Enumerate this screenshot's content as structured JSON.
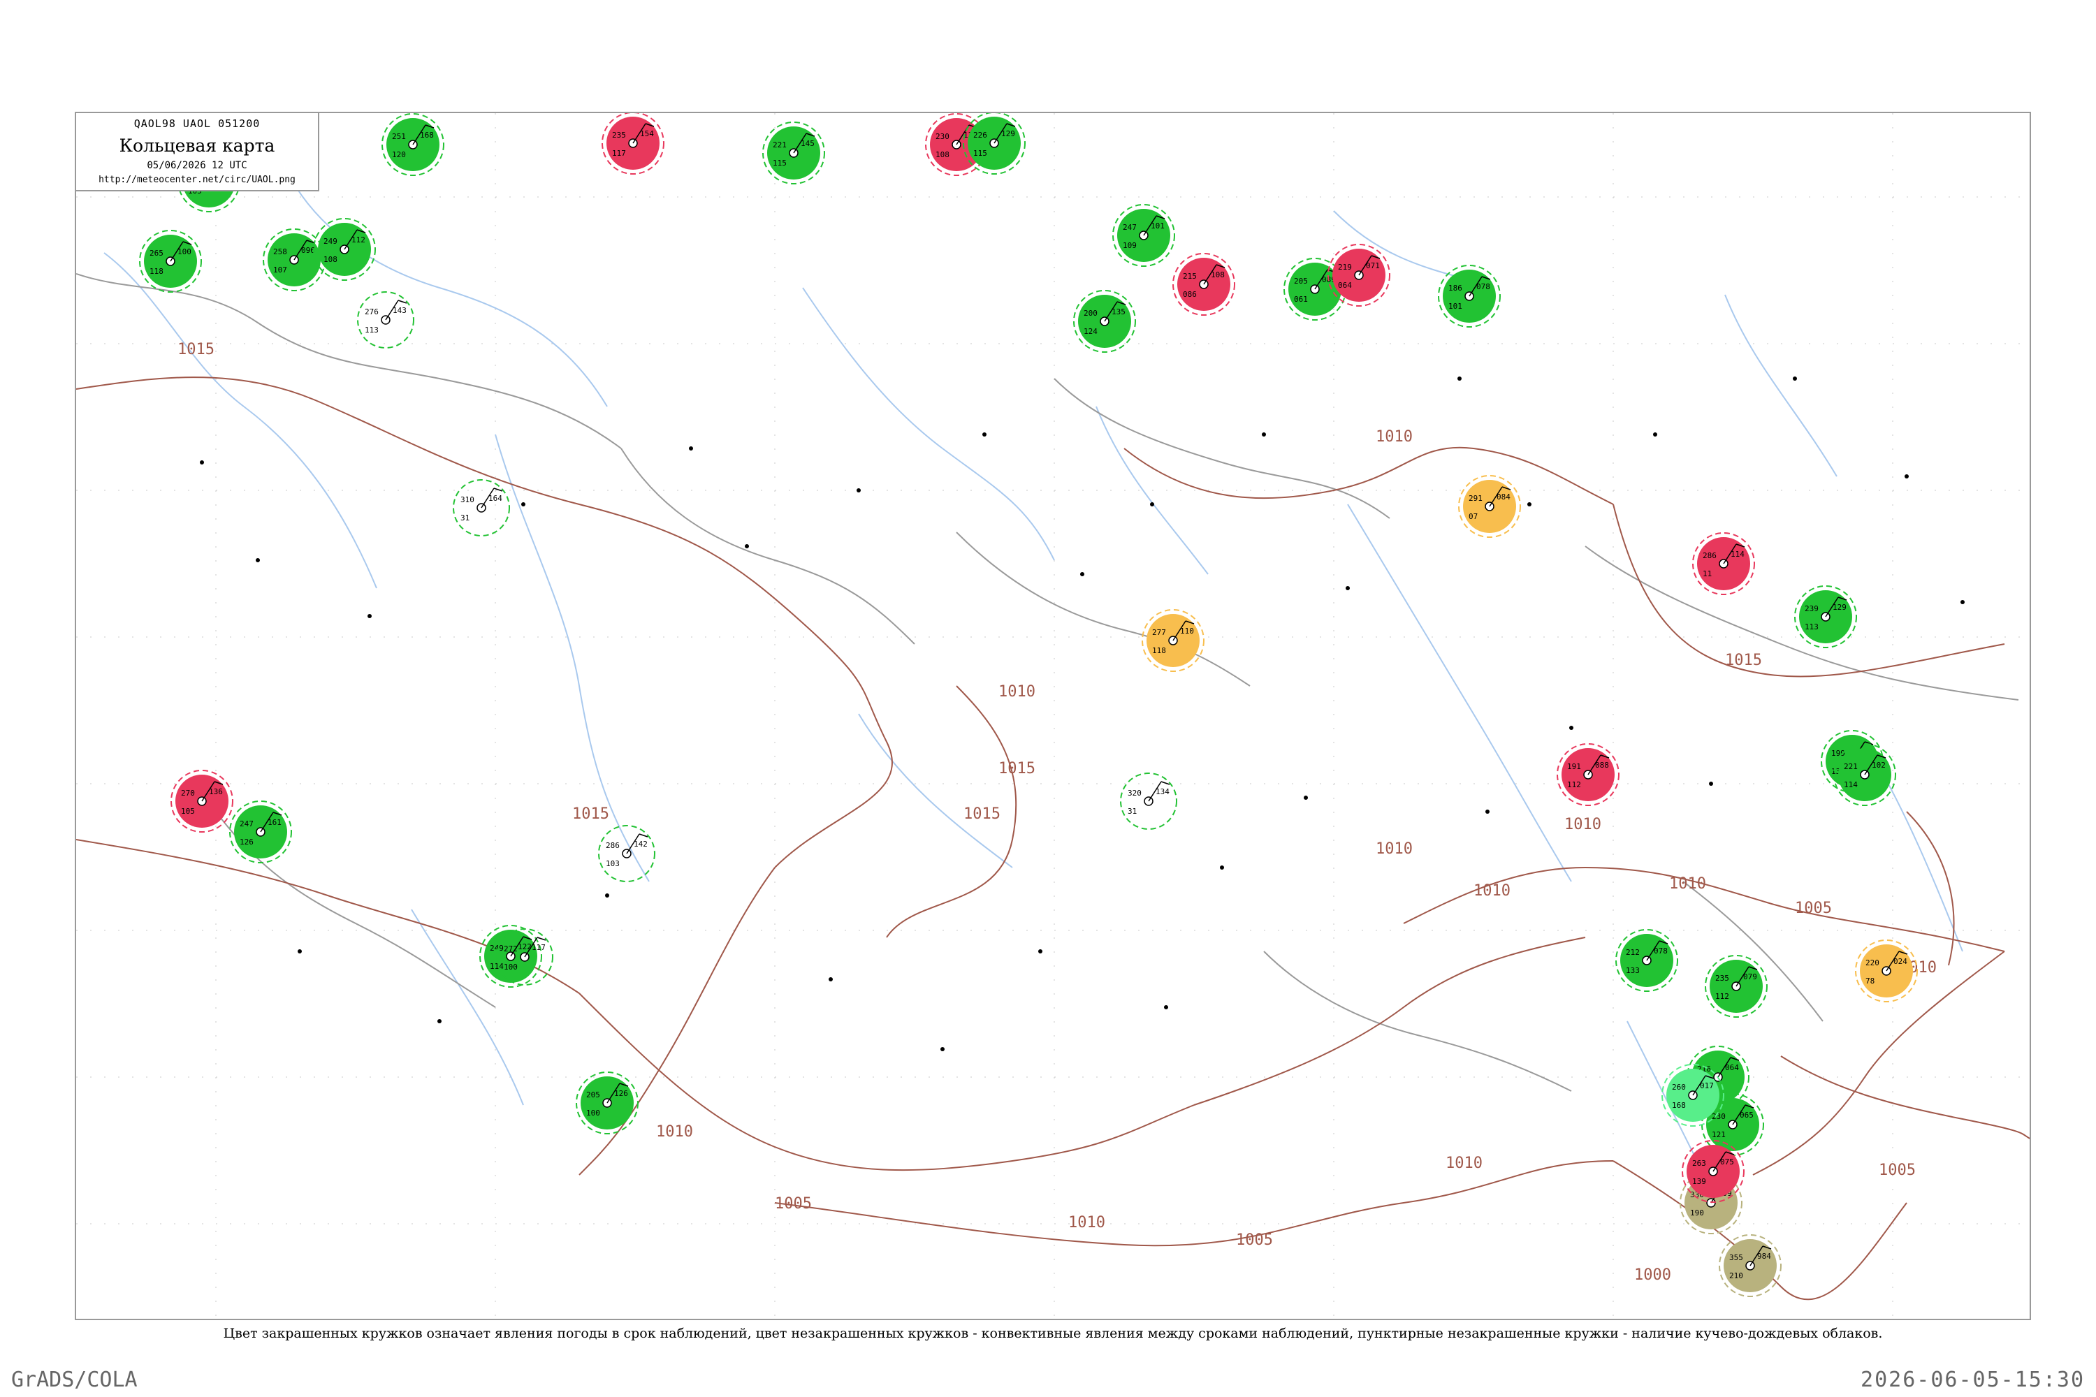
{
  "header": {
    "code": "QAOL98  UAOL  051200",
    "title": "Кольцевая карта",
    "date": "05/06/2026 12 UTC",
    "url": "http://meteocenter.net/circ/UAOL.png"
  },
  "caption": "Цвет закрашенных кружков означает явления погоды в срок наблюдений, цвет незакрашенных кружков - конвективные явления между сроками наблюдений, пунктирные незакрашенные кружки - наличие кучево-дождевых облаков.",
  "footer": {
    "left": "GrADS/COLA",
    "right": "2026-06-05-15:30"
  },
  "colors": {
    "green": "#22c233",
    "red": "#e8385c",
    "orange": "#f8be4e",
    "olive": "#b8b27e",
    "mint": "#58ee8a",
    "isobar": "#a0584a",
    "river": "#a9c9ee"
  },
  "isobars": [
    {
      "text": "1015"
    },
    {
      "text": "1015"
    },
    {
      "text": "1010"
    },
    {
      "text": "1015"
    },
    {
      "text": "1010"
    },
    {
      "text": "1010"
    },
    {
      "text": "1015"
    },
    {
      "text": "1010"
    },
    {
      "text": "1015"
    },
    {
      "text": "1010"
    },
    {
      "text": "1010"
    },
    {
      "text": "1005"
    },
    {
      "text": "1010"
    },
    {
      "text": "1005"
    },
    {
      "text": "1005"
    },
    {
      "text": "1010"
    },
    {
      "text": "1005"
    },
    {
      "text": "1000"
    },
    {
      "text": "1010"
    },
    {
      "text": "1010"
    }
  ],
  "stations": [
    {
      "t": "251",
      "p": "168",
      "d": "120",
      "c": "green"
    },
    {
      "t": "235",
      "p": "154",
      "d": "117",
      "c": "red"
    },
    {
      "t": "221",
      "p": "145",
      "d": "115",
      "c": "green"
    },
    {
      "t": "230",
      "p": "139",
      "d": "108",
      "c": "red"
    },
    {
      "t": "226",
      "p": "129",
      "d": "115",
      "c": "green"
    },
    {
      "t": "247",
      "p": "101",
      "d": "109",
      "c": "green"
    },
    {
      "t": "200",
      "p": "135",
      "d": "124",
      "c": "green"
    },
    {
      "t": "215",
      "p": "108",
      "d": "086",
      "c": "red"
    },
    {
      "t": "205",
      "p": "089",
      "d": "061",
      "c": "green"
    },
    {
      "t": "219",
      "p": "071",
      "d": "064",
      "c": "red"
    },
    {
      "t": "186",
      "p": "078",
      "d": "101",
      "c": "green"
    },
    {
      "t": "291",
      "p": "084",
      "d": "07",
      "c": "orange"
    },
    {
      "t": "277",
      "p": "110",
      "d": "118",
      "c": "orange"
    },
    {
      "t": "286",
      "p": "114",
      "d": "11",
      "c": "red"
    },
    {
      "t": "239",
      "p": "129",
      "d": "113",
      "c": "green"
    },
    {
      "t": "199",
      "p": "099",
      "d": "134",
      "c": "green"
    },
    {
      "t": "221",
      "p": "102",
      "d": "114",
      "c": "green"
    },
    {
      "t": "191",
      "p": "088",
      "d": "112",
      "c": "red"
    },
    {
      "t": "220",
      "p": "024",
      "d": "78",
      "c": "orange"
    },
    {
      "t": "235",
      "p": "079",
      "d": "112",
      "c": "green"
    },
    {
      "t": "230",
      "p": "065",
      "d": "121",
      "c": "green"
    },
    {
      "t": "216",
      "p": "064",
      "d": "118",
      "c": "green"
    },
    {
      "t": "212",
      "p": "078",
      "d": "133",
      "c": "green"
    },
    {
      "t": "260",
      "p": "017",
      "d": "168",
      "c": "mint"
    },
    {
      "t": "330",
      "p": "999",
      "d": "190",
      "c": "olive"
    },
    {
      "t": "355",
      "p": "984",
      "d": "210",
      "c": "olive"
    },
    {
      "t": "263",
      "p": "075",
      "d": "139",
      "c": "red"
    },
    {
      "t": "270",
      "p": "136",
      "d": "105",
      "c": "red"
    },
    {
      "t": "247",
      "p": "161",
      "d": "126",
      "c": "green"
    },
    {
      "t": "249",
      "p": "122",
      "d": "114",
      "c": "green"
    },
    {
      "t": "205",
      "p": "126",
      "d": "100",
      "c": "green"
    },
    {
      "t": "212",
      "p": "140",
      "d": "105",
      "c": "green"
    },
    {
      "t": "265",
      "p": "100",
      "d": "118",
      "c": "green"
    },
    {
      "t": "258",
      "p": "096",
      "d": "107",
      "c": "green"
    },
    {
      "t": "249",
      "p": "112",
      "d": "108",
      "c": "green"
    },
    {
      "t": "276",
      "p": "143",
      "d": "113",
      "c": "none"
    },
    {
      "t": "310",
      "p": "164",
      "d": "31",
      "c": "none"
    },
    {
      "t": "320",
      "p": "134",
      "d": "31",
      "c": "none"
    },
    {
      "t": "286",
      "p": "142",
      "d": "103",
      "c": "none"
    },
    {
      "t": "272",
      "p": "117",
      "d": "100",
      "c": "none"
    }
  ]
}
